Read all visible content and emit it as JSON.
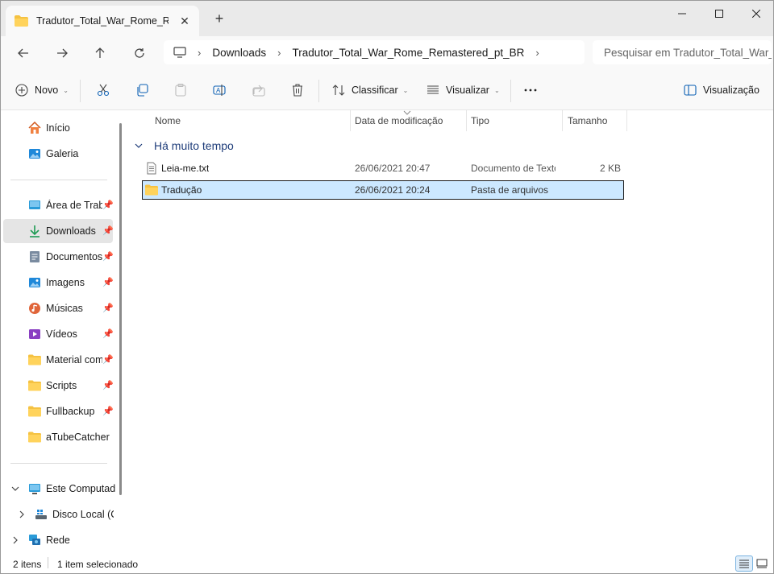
{
  "tab": {
    "title": "Tradutor_Total_War_Rome_Remastered_pt_BR"
  },
  "address": {
    "segments": [
      "Downloads",
      "Tradutor_Total_War_Rome_Remastered_pt_BR"
    ],
    "search_placeholder": "Pesquisar em Tradutor_Total_War_Rome_Remastered_pt_BR"
  },
  "toolbar": {
    "new_label": "Novo",
    "sort_label": "Classificar",
    "view_label": "Visualizar",
    "preview_label": "Visualização"
  },
  "sidebar": {
    "top": [
      {
        "label": "Início",
        "icon": "home-icon"
      },
      {
        "label": "Galeria",
        "icon": "gallery-icon"
      }
    ],
    "quick": [
      {
        "label": "Área de Trabalho",
        "icon": "desktop-icon"
      },
      {
        "label": "Downloads",
        "icon": "download-icon"
      },
      {
        "label": "Documentos",
        "icon": "documents-icon"
      },
      {
        "label": "Imagens",
        "icon": "pictures-icon"
      },
      {
        "label": "Músicas",
        "icon": "music-icon"
      },
      {
        "label": "Vídeos",
        "icon": "videos-icon"
      },
      {
        "label": "Material complementar",
        "icon": "folder-icon"
      },
      {
        "label": "Scripts",
        "icon": "folder-icon"
      },
      {
        "label": "Fullbackup",
        "icon": "folder-icon"
      },
      {
        "label": "aTubeCatcher",
        "icon": "folder-icon"
      }
    ],
    "bottom": [
      {
        "label": "Este Computador",
        "icon": "computer-icon"
      },
      {
        "label": "Disco Local (C:)",
        "icon": "drive-icon"
      },
      {
        "label": "Rede",
        "icon": "network-icon"
      }
    ]
  },
  "columns": [
    "Nome",
    "Data de modificação",
    "Tipo",
    "Tamanho"
  ],
  "group": {
    "label": "Há muito tempo"
  },
  "files": [
    {
      "name": "Leia-me.txt",
      "date": "26/06/2021 20:47",
      "type": "Documento de Texto",
      "size": "2 KB",
      "icon": "text-file-icon"
    },
    {
      "name": "Tradução",
      "date": "26/06/2021 20:24",
      "type": "Pasta de arquivos",
      "size": "",
      "icon": "folder-icon"
    }
  ],
  "status": {
    "count": "2 itens",
    "selected": "1 item selecionado"
  },
  "colors": {
    "folder": "#f5c242",
    "selection_bg": "#cce8ff",
    "accent": "#0067c0",
    "group_text": "#1f3d7a"
  }
}
